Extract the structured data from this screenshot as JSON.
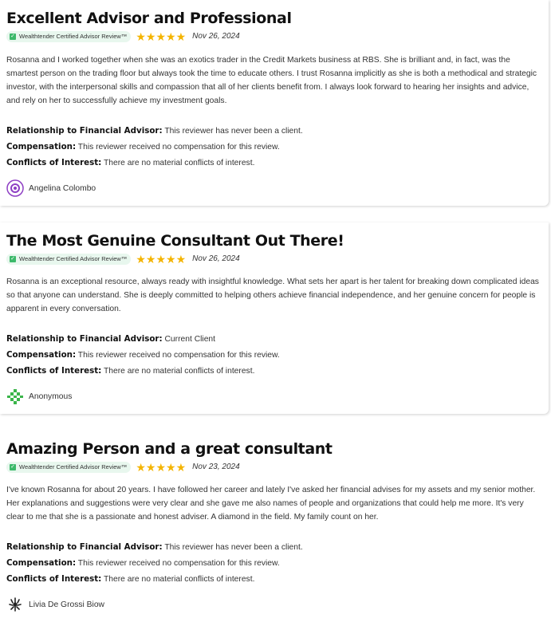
{
  "reviews": [
    {
      "title": "Excellent Advisor and Professional",
      "badge": "Wealthtender Certified Advisor Review™",
      "stars": 5,
      "date": "Nov 26, 2024",
      "body": "Rosanna and I worked together when she was an exotics trader in the Credit Markets business at RBS. She is brilliant and, in fact, was the smartest person on the trading floor but always took the time to educate others. I trust Rosanna implicitly as she is both a methodical and strategic investor, with the interpersonal skills and compassion that all of her clients benefit from. I always look forward to hearing her insights and advice, and rely on her to successfully achieve my investment goals.",
      "relationship_label": "Relationship to Financial Advisor:",
      "relationship": "This reviewer has never been a client.",
      "compensation_label": "Compensation:",
      "compensation": "This reviewer received no compensation for this review.",
      "conflicts_label": "Conflicts of Interest:",
      "conflicts": "There are no material conflicts of interest.",
      "author": "Angelina Colombo",
      "avatar_color": "#8e3fc4"
    },
    {
      "title": "The Most Genuine Consultant Out There!",
      "badge": "Wealthtender Certified Advisor Review™",
      "stars": 5,
      "date": "Nov 26, 2024",
      "body": "Rosanna is an exceptional resource, always ready with insightful knowledge. What sets her apart is her talent for breaking down complicated ideas so that anyone can understand. She is deeply committed to helping others achieve financial independence, and her genuine concern for people is apparent in every conversation.",
      "relationship_label": "Relationship to Financial Advisor:",
      "relationship": "Current Client",
      "compensation_label": "Compensation:",
      "compensation": "This reviewer received no compensation for this review.",
      "conflicts_label": "Conflicts of Interest:",
      "conflicts": "There are no material conflicts of interest.",
      "author": "Anonymous",
      "avatar_color": "#3bb54a"
    },
    {
      "title": "Amazing Person and a great consultant",
      "badge": "Wealthtender Certified Advisor Review™",
      "stars": 5,
      "date": "Nov 23, 2024",
      "body": "I've known Rosanna for about 20 years. I have followed her career and lately I've asked her financial advises for my assets and my senior mother. Her explanations and suggestions were very clear and she gave me also names of people and organizations that could help me more. It's very clear to me that she is a passionate and honest adviser. A diamond in the field. My family count on her.",
      "relationship_label": "Relationship to Financial Advisor:",
      "relationship": "This reviewer has never been a client.",
      "compensation_label": "Compensation:",
      "compensation": "This reviewer received no compensation for this review.",
      "conflicts_label": "Conflicts of Interest:",
      "conflicts": "There are no material conflicts of interest.",
      "author": "Livia De Grossi Biow",
      "avatar_color": "#222222"
    }
  ]
}
